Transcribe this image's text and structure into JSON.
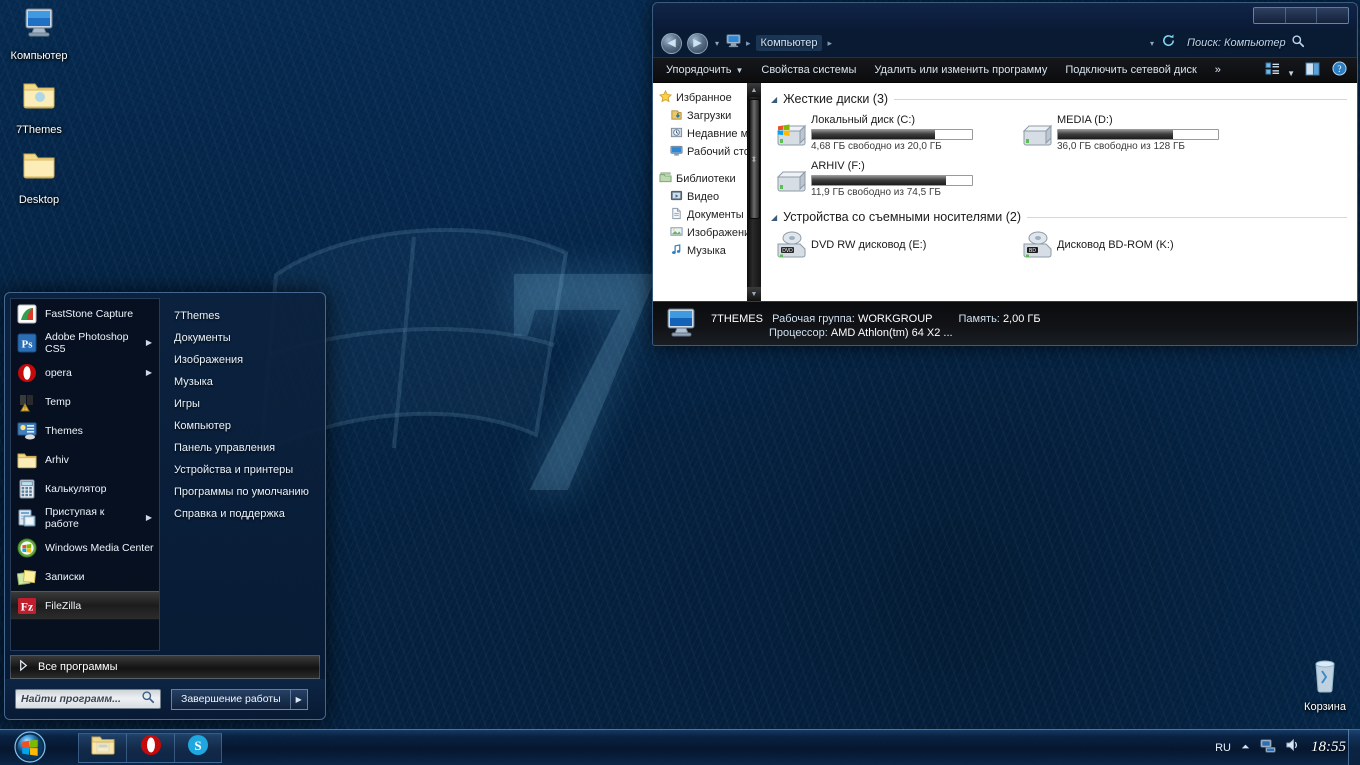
{
  "desktop": {
    "icons": [
      {
        "label": "Компьютер",
        "icon": "computer-icon"
      },
      {
        "label": "7Themes",
        "icon": "folder-icon"
      },
      {
        "label": "Desktop",
        "icon": "folder-icon"
      },
      {
        "label": "Корзина",
        "icon": "recycle-bin-icon"
      }
    ]
  },
  "explorer": {
    "address": {
      "crumb": "Компьютер",
      "icon": "computer-icon"
    },
    "search": {
      "placeholder": "Поиск: Компьютер",
      "icon": "search-icon"
    },
    "toolbar": {
      "organize": "Упорядочить",
      "system_properties": "Свойства системы",
      "uninstall_change": "Удалить или изменить программу",
      "map_network_drive": "Подключить сетевой диск",
      "overflow": "»",
      "change_view_icon": "change-view-icon",
      "preview_pane_icon": "preview-pane-icon",
      "help_icon": "help-icon"
    },
    "navpane": [
      {
        "label": "Избранное",
        "icon": "star-icon",
        "level": 0
      },
      {
        "label": "Загрузки",
        "icon": "downloads-icon",
        "level": 1
      },
      {
        "label": "Недавние места",
        "icon": "recent-places-icon",
        "level": 1
      },
      {
        "label": "Рабочий стол",
        "icon": "desktop-icon",
        "level": 1
      },
      {
        "label": "Библиотеки",
        "icon": "libraries-icon",
        "level": 0
      },
      {
        "label": "Видео",
        "icon": "video-icon",
        "level": 1
      },
      {
        "label": "Документы",
        "icon": "documents-icon",
        "level": 1
      },
      {
        "label": "Изображения",
        "icon": "pictures-icon",
        "level": 1
      },
      {
        "label": "Музыка",
        "icon": "music-icon",
        "level": 1
      }
    ],
    "groups": [
      {
        "title": "Жесткие диски (3)",
        "items": [
          {
            "name": "Локальный диск (C:)",
            "size_text": "4,68 ГБ свободно из 20,0 ГБ",
            "used_percent": 77,
            "icon": "system-drive-icon"
          },
          {
            "name": "MEDIA (D:)",
            "size_text": "36,0 ГБ свободно из 128 ГБ",
            "used_percent": 72,
            "icon": "drive-icon"
          },
          {
            "name": "ARHIV (F:)",
            "size_text": "11,9 ГБ свободно из 74,5 ГБ",
            "used_percent": 84,
            "icon": "drive-icon"
          }
        ]
      },
      {
        "title": "Устройства со съемными носителями (2)",
        "items": [
          {
            "name": "DVD RW дисковод (E:)",
            "icon": "dvd-drive-icon"
          },
          {
            "name": "Дисковод BD-ROM (K:)",
            "icon": "bd-drive-icon"
          }
        ]
      }
    ],
    "status": {
      "computer_name": "7THEMES",
      "workgroup_label": "Рабочая группа:",
      "workgroup_value": "WORKGROUP",
      "memory_label": "Память:",
      "memory_value": "2,00 ГБ",
      "processor_label": "Процессор:",
      "processor_value": "AMD Athlon(tm) 64 X2 ..."
    }
  },
  "start_menu": {
    "programs": [
      {
        "label": "FastStone Capture",
        "icon": "faststone-icon",
        "arrow": false,
        "selected": false
      },
      {
        "label": "Adobe Photoshop CS5",
        "icon": "photoshop-icon",
        "arrow": true,
        "selected": false
      },
      {
        "label": "opera",
        "icon": "opera-icon",
        "arrow": true,
        "selected": false
      },
      {
        "label": "Temp",
        "icon": "temp-icon",
        "arrow": false,
        "selected": false
      },
      {
        "label": "Themes",
        "icon": "themes-icon",
        "arrow": false,
        "selected": false
      },
      {
        "label": "Arhiv",
        "icon": "folder-icon",
        "arrow": false,
        "selected": false
      },
      {
        "label": "Калькулятор",
        "icon": "calculator-icon",
        "arrow": false,
        "selected": false
      },
      {
        "label": "Приступая к работе",
        "icon": "getting-started-icon",
        "arrow": true,
        "selected": false
      },
      {
        "label": "Windows Media Center",
        "icon": "media-center-icon",
        "arrow": false,
        "selected": false
      },
      {
        "label": "Записки",
        "icon": "sticky-notes-icon",
        "arrow": false,
        "selected": false
      },
      {
        "label": "FileZilla",
        "icon": "filezilla-icon",
        "arrow": false,
        "selected": true
      }
    ],
    "all_programs": "Все программы",
    "places": [
      "7Themes",
      "Документы",
      "Изображения",
      "Музыка",
      "Игры",
      "Компьютер",
      "Панель управления",
      "Устройства и принтеры",
      "Программы по умолчанию",
      "Справка и поддержка"
    ],
    "search_placeholder": "Найти программ...",
    "shutdown": "Завершение работы"
  },
  "taskbar": {
    "start_icon": "windows-start-orb",
    "tasks": [
      {
        "name": "explorer-task",
        "icon": "folder-icon"
      },
      {
        "name": "opera-task",
        "icon": "opera-icon"
      },
      {
        "name": "skype-task",
        "icon": "skype-icon"
      }
    ],
    "tray": {
      "language": "RU",
      "show_hidden_icon": "chevron-up-icon",
      "network_icon": "network-icon",
      "volume_icon": "volume-icon",
      "clock": "18:55"
    }
  },
  "colors": {
    "accent_blue": "#1b6fb5",
    "window_glass": "#0a1830",
    "taskbar": "#0a2242"
  }
}
